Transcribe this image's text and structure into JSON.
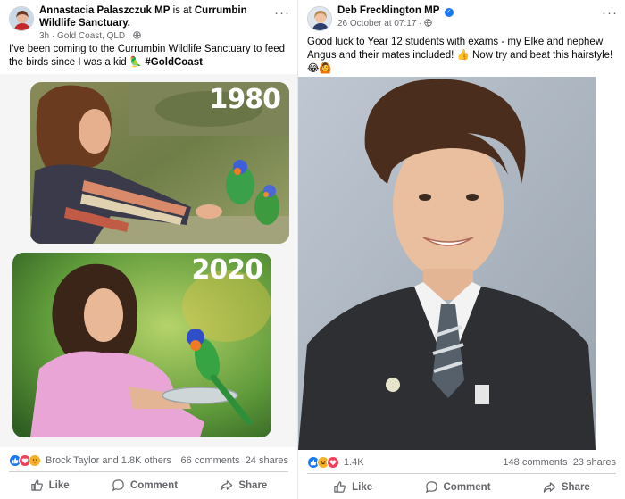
{
  "left_post": {
    "author": "Annastacia Palaszczuk MP",
    "is_at": "is at",
    "place": "Currumbin Wildlife Sanctuary.",
    "meta": "3h · Gold Coast, QLD ·",
    "text": "I've been coming to the Currumbin Wildlife Sanctuary to feed the birds since I was a kid 🦜",
    "hashtag": "#GoldCoast",
    "photo_top_label": "1980",
    "photo_bottom_label": "2020",
    "reactions_text": "Brock Taylor and 1.8K others",
    "comments": "66 comments",
    "shares": "24 shares",
    "like_label": "Like",
    "comment_label": "Comment",
    "share_label": "Share"
  },
  "right_post": {
    "author": "Deb Frecklington MP",
    "meta": "26 October at 07:17 ·",
    "text": "Good luck to Year 12 students with exams - my Elke and nephew Angus and their mates included! 👍 Now try and beat this hairstyle!",
    "emojis": "😂🙆",
    "reactions_text": "1.4K",
    "comments": "148 comments",
    "shares": "23 shares",
    "like_label": "Like",
    "comment_label": "Comment",
    "share_label": "Share"
  },
  "colors": {
    "facebook_blue": "#1877f2",
    "meta_gray": "#65676b",
    "love_red": "#f33e58",
    "haha_yellow": "#f7b125"
  }
}
